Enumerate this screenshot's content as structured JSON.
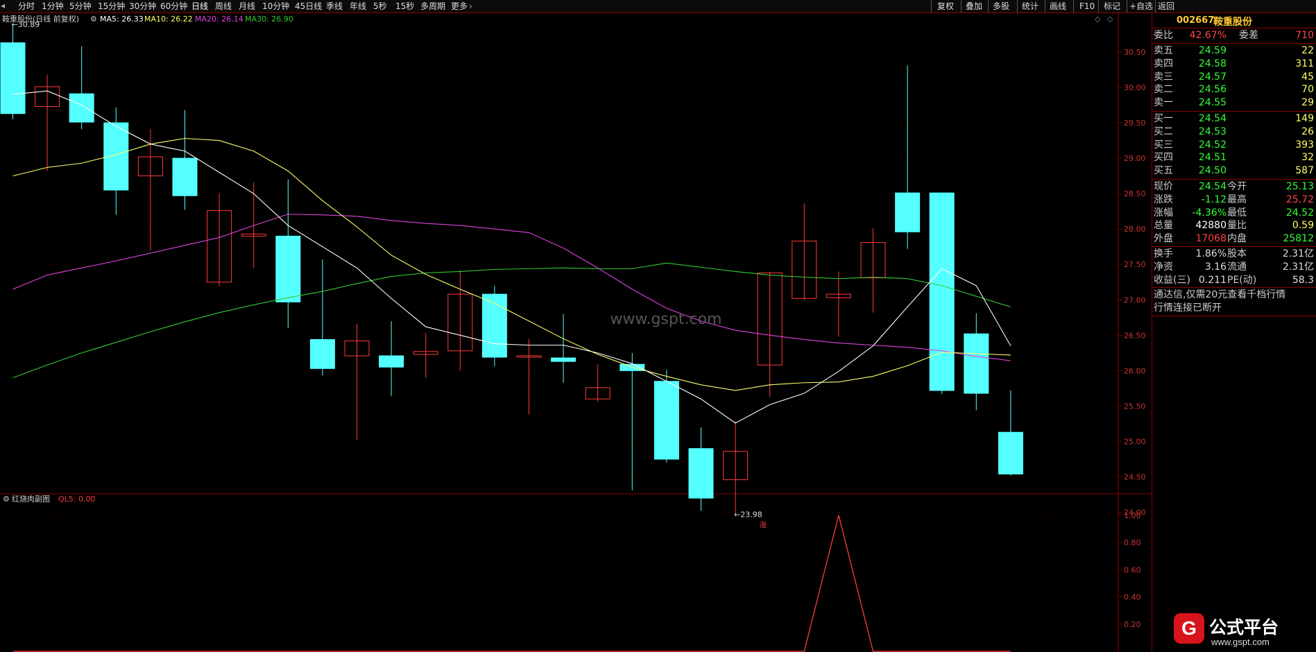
{
  "topbar": {
    "left_items": [
      "分时",
      "1分钟",
      "5分钟",
      "15分钟",
      "30分钟",
      "60分钟",
      "日线",
      "周线",
      "月线",
      "10分钟",
      "45日线",
      "季线",
      "年线",
      "5秒",
      "15秒",
      "多周期",
      "更多"
    ],
    "active": "日线",
    "right_items": [
      "复权",
      "叠加",
      "多股",
      "统计",
      "画线",
      "F10",
      "标记",
      "+自选",
      "返回"
    ]
  },
  "legend": {
    "name": "鞍重股份(日线 前复权)",
    "ma5": "MA5: 26.33",
    "ma10": "MA10: 26.22",
    "ma20": "MA20: 26.14",
    "ma30": "MA30: 26.90"
  },
  "annotations": {
    "high": "30.89",
    "low": "23.98",
    "zhang": "涨"
  },
  "watermark": "www.gspt.com",
  "sub_legend": {
    "name": "红烧肉副图",
    "ql5": "QL5: 0.00"
  },
  "colors": {
    "up": "#ff3b3b",
    "down": "#54ffff",
    "ma5": "#ffffff",
    "ma10": "#ffff66",
    "ma20": "#dd44dd",
    "ma30": "#33cc33",
    "axis": "#8b0000",
    "price_green": "#33ff33",
    "price_red": "#ff4444"
  },
  "chart_data": [
    {
      "type": "candlestick",
      "title": "鞍重股份(日线 前复权)",
      "ylim": [
        23.8,
        30.95
      ],
      "y_ticks": [
        "30.50",
        "30.00",
        "29.50",
        "29.00",
        "28.50",
        "28.00",
        "27.50",
        "27.00",
        "26.50",
        "26.00",
        "25.50",
        "25.00",
        "24.50",
        "24.00"
      ],
      "candles": [
        {
          "o": 30.63,
          "h": 30.89,
          "l": 29.55,
          "c": 29.63
        },
        {
          "o": 29.73,
          "h": 30.18,
          "l": 28.82,
          "c": 30.01
        },
        {
          "o": 29.91,
          "h": 30.58,
          "l": 29.41,
          "c": 29.51
        },
        {
          "o": 29.5,
          "h": 29.72,
          "l": 28.2,
          "c": 28.55
        },
        {
          "o": 28.75,
          "h": 29.41,
          "l": 27.7,
          "c": 29.02
        },
        {
          "o": 29.0,
          "h": 29.68,
          "l": 28.27,
          "c": 28.47
        },
        {
          "o": 27.25,
          "h": 28.5,
          "l": 27.2,
          "c": 28.26
        },
        {
          "o": 27.9,
          "h": 28.66,
          "l": 27.45,
          "c": 27.93
        },
        {
          "o": 27.9,
          "h": 28.7,
          "l": 26.6,
          "c": 26.97
        },
        {
          "o": 26.44,
          "h": 27.57,
          "l": 25.93,
          "c": 26.03
        },
        {
          "o": 26.21,
          "h": 26.66,
          "l": 25.02,
          "c": 26.42
        },
        {
          "o": 26.21,
          "h": 26.7,
          "l": 25.64,
          "c": 26.05
        },
        {
          "o": 26.23,
          "h": 26.53,
          "l": 25.9,
          "c": 26.27
        },
        {
          "o": 26.28,
          "h": 27.42,
          "l": 26.0,
          "c": 27.08
        },
        {
          "o": 27.08,
          "h": 27.2,
          "l": 26.06,
          "c": 26.19
        },
        {
          "o": 26.19,
          "h": 26.45,
          "l": 25.38,
          "c": 26.21
        },
        {
          "o": 26.18,
          "h": 26.8,
          "l": 25.83,
          "c": 26.13
        },
        {
          "o": 25.6,
          "h": 26.09,
          "l": 25.56,
          "c": 25.76
        },
        {
          "o": 26.09,
          "h": 26.25,
          "l": 24.31,
          "c": 26.0
        },
        {
          "o": 25.85,
          "h": 26.01,
          "l": 24.7,
          "c": 24.75
        },
        {
          "o": 24.9,
          "h": 25.2,
          "l": 24.02,
          "c": 24.2
        },
        {
          "o": 24.46,
          "h": 25.29,
          "l": 23.98,
          "c": 24.86
        },
        {
          "o": 26.08,
          "h": 27.4,
          "l": 25.63,
          "c": 27.38
        },
        {
          "o": 27.02,
          "h": 28.36,
          "l": 27.0,
          "c": 27.83
        },
        {
          "o": 27.03,
          "h": 27.4,
          "l": 26.48,
          "c": 27.08
        },
        {
          "o": 27.31,
          "h": 28.01,
          "l": 26.82,
          "c": 27.81
        },
        {
          "o": 28.51,
          "h": 30.31,
          "l": 27.72,
          "c": 27.96
        },
        {
          "o": 28.51,
          "h": 28.51,
          "l": 25.67,
          "c": 25.72
        },
        {
          "o": 26.52,
          "h": 26.81,
          "l": 25.44,
          "c": 25.68
        },
        {
          "o": 25.13,
          "h": 25.72,
          "l": 24.52,
          "c": 24.54
        }
      ],
      "ma5": [
        29.9,
        29.95,
        29.75,
        29.45,
        29.2,
        29.1,
        28.8,
        28.5,
        28.05,
        27.75,
        27.45,
        27.02,
        26.62,
        26.5,
        26.38,
        26.36,
        26.36,
        26.25,
        26.1,
        25.85,
        25.6,
        25.26,
        25.52,
        25.68,
        25.99,
        26.35,
        26.9,
        27.44,
        27.2,
        26.35
      ],
      "ma10": [
        28.75,
        28.87,
        28.93,
        29.05,
        29.2,
        29.28,
        29.25,
        29.1,
        28.82,
        28.4,
        28.03,
        27.63,
        27.36,
        27.15,
        26.95,
        26.7,
        26.45,
        26.23,
        26.05,
        25.92,
        25.8,
        25.72,
        25.8,
        25.83,
        25.84,
        25.92,
        26.07,
        26.26,
        26.24,
        26.22
      ],
      "ma20": [
        27.15,
        27.35,
        27.45,
        27.55,
        27.66,
        27.77,
        27.88,
        28.05,
        28.21,
        28.2,
        28.18,
        28.12,
        28.08,
        28.05,
        28.0,
        27.95,
        27.73,
        27.45,
        27.15,
        26.88,
        26.7,
        26.57,
        26.5,
        26.44,
        26.39,
        26.36,
        26.33,
        26.28,
        26.2,
        26.14
      ],
      "ma30": [
        25.9,
        26.08,
        26.25,
        26.4,
        26.55,
        26.69,
        26.82,
        26.93,
        27.03,
        27.12,
        27.23,
        27.33,
        27.38,
        27.4,
        27.43,
        27.44,
        27.45,
        27.44,
        27.44,
        27.52,
        27.46,
        27.4,
        27.35,
        27.32,
        27.3,
        27.32,
        27.3,
        27.2,
        27.05,
        26.9
      ]
    },
    {
      "type": "line",
      "title": "红烧肉副图",
      "ylim": [
        0,
        1.05
      ],
      "y_ticks": [
        "1.00",
        "0.80",
        "0.60",
        "0.40",
        "0.20"
      ],
      "series": [
        {
          "name": "QL5",
          "x": [
            22,
            23,
            24,
            25,
            26
          ],
          "values": [
            0,
            0,
            1.0,
            0,
            0
          ]
        }
      ]
    }
  ],
  "quote": {
    "code": "002667",
    "name": "鞍重股份",
    "weibi_label": "委比",
    "weibi": "42.67%",
    "weicha_label": "委差",
    "weicha": "710",
    "sell": [
      {
        "label": "卖五",
        "price": "24.59",
        "vol": "22"
      },
      {
        "label": "卖四",
        "price": "24.58",
        "vol": "311"
      },
      {
        "label": "卖三",
        "price": "24.57",
        "vol": "45"
      },
      {
        "label": "卖二",
        "price": "24.56",
        "vol": "70"
      },
      {
        "label": "卖一",
        "price": "24.55",
        "vol": "29"
      }
    ],
    "buy": [
      {
        "label": "买一",
        "price": "24.54",
        "vol": "149"
      },
      {
        "label": "买二",
        "price": "24.53",
        "vol": "26"
      },
      {
        "label": "买三",
        "price": "24.52",
        "vol": "393"
      },
      {
        "label": "买四",
        "price": "24.51",
        "vol": "32"
      },
      {
        "label": "买五",
        "price": "24.50",
        "vol": "587"
      }
    ],
    "stats": [
      {
        "l1": "现价",
        "v1": "24.54",
        "c1": "g",
        "l2": "今开",
        "v2": "25.13",
        "c2": "g"
      },
      {
        "l1": "涨跌",
        "v1": "-1.12",
        "c1": "g",
        "l2": "最高",
        "v2": "25.72",
        "c2": "r"
      },
      {
        "l1": "涨幅",
        "v1": "-4.36%",
        "c1": "g",
        "l2": "最低",
        "v2": "24.52",
        "c2": "g"
      },
      {
        "l1": "总量",
        "v1": "42880",
        "c1": "w",
        "l2": "量比",
        "v2": "0.59",
        "c2": "y"
      },
      {
        "l1": "外盘",
        "v1": "17068",
        "c1": "r",
        "l2": "内盘",
        "v2": "25812",
        "c2": "g"
      }
    ],
    "stats2": [
      {
        "l1": "换手",
        "v1": "1.86%",
        "l2": "股本",
        "v2": "2.31亿"
      },
      {
        "l1": "净资",
        "v1": "3.16",
        "l2": "流通",
        "v2": "2.31亿"
      },
      {
        "l1": "收益(三)",
        "v1": "0.211",
        "l2": "PE(动)",
        "v2": "58.3"
      }
    ],
    "msg1": "通达信,仅需20元查看千档行情",
    "msg2": "行情连接已断开"
  },
  "logo": {
    "text": "公式平台",
    "url": "www.gspt.com"
  }
}
